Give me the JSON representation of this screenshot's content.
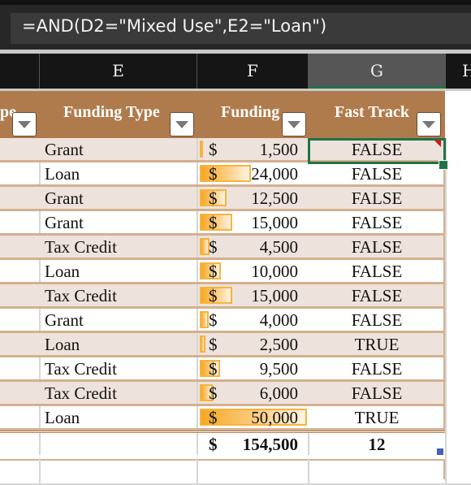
{
  "formula_bar": {
    "formula": "=AND(D2=\"Mixed Use\",E2=\"Loan\")"
  },
  "column_headers": [
    {
      "label": "E",
      "selected": false
    },
    {
      "label": "F",
      "selected": false
    },
    {
      "label": "G",
      "selected": true
    },
    {
      "label": "H",
      "selected": false
    }
  ],
  "table": {
    "headers": {
      "prev_col_fragment": "pe",
      "funding_type": "Funding Type",
      "funding": "Funding",
      "fast_track": "Fast Track"
    },
    "rows": [
      {
        "funding_type": "Grant",
        "currency": "$",
        "funding": "1,500",
        "funding_value": 1500,
        "fast_track": "FALSE"
      },
      {
        "funding_type": "Loan",
        "currency": "$",
        "funding": "24,000",
        "funding_value": 24000,
        "fast_track": "FALSE"
      },
      {
        "funding_type": "Grant",
        "currency": "$",
        "funding": "12,500",
        "funding_value": 12500,
        "fast_track": "FALSE"
      },
      {
        "funding_type": "Grant",
        "currency": "$",
        "funding": "15,000",
        "funding_value": 15000,
        "fast_track": "FALSE"
      },
      {
        "funding_type": "Tax Credit",
        "currency": "$",
        "funding": "4,500",
        "funding_value": 4500,
        "fast_track": "FALSE"
      },
      {
        "funding_type": "Loan",
        "currency": "$",
        "funding": "10,000",
        "funding_value": 10000,
        "fast_track": "FALSE"
      },
      {
        "funding_type": "Tax Credit",
        "currency": "$",
        "funding": "15,000",
        "funding_value": 15000,
        "fast_track": "FALSE"
      },
      {
        "funding_type": "Grant",
        "currency": "$",
        "funding": "4,000",
        "funding_value": 4000,
        "fast_track": "FALSE"
      },
      {
        "funding_type": "Loan",
        "currency": "$",
        "funding": "2,500",
        "funding_value": 2500,
        "fast_track": "TRUE"
      },
      {
        "funding_type": "Tax Credit",
        "currency": "$",
        "funding": "9,500",
        "funding_value": 9500,
        "fast_track": "FALSE"
      },
      {
        "funding_type": "Tax Credit",
        "currency": "$",
        "funding": "6,000",
        "funding_value": 6000,
        "fast_track": "FALSE"
      },
      {
        "funding_type": "Loan",
        "currency": "$",
        "funding": "50,000",
        "funding_value": 50000,
        "fast_track": "TRUE"
      }
    ],
    "totals": {
      "currency": "$",
      "funding": "154,500",
      "fast_track": "12"
    },
    "data_bar_max": 50000
  },
  "colors": {
    "header_fill": "#b07b4c",
    "band_fill": "#eee3dc",
    "selection": "#217346",
    "data_bar": "#f7a823"
  }
}
